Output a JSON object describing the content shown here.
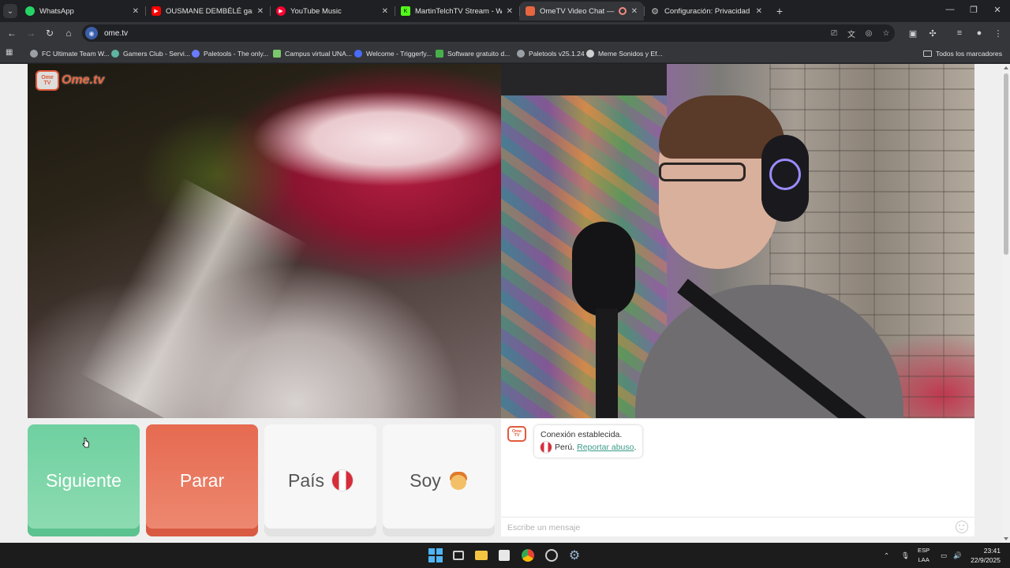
{
  "browser": {
    "tabs": [
      {
        "label": "WhatsApp",
        "favicon_color": "#25d366",
        "active": false
      },
      {
        "label": "OUSMANE DEMBÉLÉ gana el B",
        "favicon_color": "#ff0000",
        "active": false
      },
      {
        "label": "YouTube Music",
        "favicon_color": "#ff0033",
        "active": false
      },
      {
        "label": "MartinTelchTV Stream - Watch",
        "favicon_color": "#53fc18",
        "active": false
      },
      {
        "label": "OmeTV Video Chat — Ome",
        "favicon_color": "#e8663f",
        "active": true
      },
      {
        "label": "Configuración: Privacidad y seg",
        "favicon_color": "#9aa0a6",
        "active": false
      }
    ],
    "address": "ome.tv",
    "bookmarks": [
      {
        "label": "FC Ultimate Team W...",
        "color": "#9aa0a6"
      },
      {
        "label": "Gamers Club - Servi...",
        "color": "#5fb3a0"
      },
      {
        "label": "Paletools - The only...",
        "color": "#6b7cff"
      },
      {
        "label": "Campus virtual UNA...",
        "color": "#7bc86c"
      },
      {
        "label": "Welcome - Triggerfy...",
        "color": "#4a6cf7"
      },
      {
        "label": "Software gratuito d...",
        "color": "#48b04a"
      },
      {
        "label": "Paletools v25.1.24",
        "color": "#9aa0a6"
      },
      {
        "label": "Meme Sonidos y Ef...",
        "color": "#d0d0d0"
      }
    ],
    "all_bookmarks_label": "Todos los marcadores"
  },
  "ometv": {
    "logo_text": "Ome.tv",
    "logo_badge": "Ome TV",
    "buttons": {
      "next": "Siguiente",
      "stop": "Parar",
      "country": "País",
      "gender": "Soy"
    },
    "chat": {
      "message_line1": "Conexión establecida.",
      "country": "Perú.",
      "report_link": "Reportar abuso",
      "report_suffix": ".",
      "input_placeholder": "Escribe un mensaje"
    },
    "colors": {
      "next_button": "#6fd0a0",
      "stop_button": "#e56a50",
      "link": "#3c9c8a"
    }
  },
  "taskbar": {
    "language_line1": "ESP",
    "language_line2": "LAA",
    "time": "23:41",
    "date": "22/9/2025"
  }
}
